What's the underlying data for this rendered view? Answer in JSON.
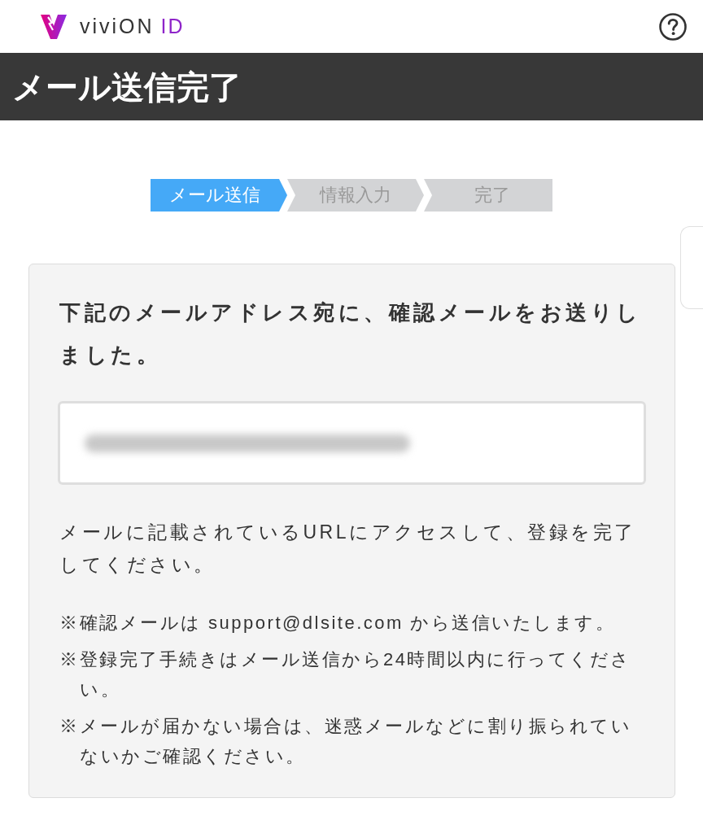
{
  "header": {
    "brand": {
      "name": "viviON",
      "suffix": "ID"
    }
  },
  "title": "メール送信完了",
  "steps": [
    {
      "label": "メール送信",
      "selected": true
    },
    {
      "label": "情報入力",
      "selected": false
    },
    {
      "label": "完了",
      "selected": false
    }
  ],
  "card": {
    "heading": "下記のメールアドレス宛に、確認メールをお送りしました。",
    "email_field": {
      "blurred": true
    },
    "instruction": "メールに記載されているURLにアクセスして、登録を完了してください。",
    "notes": [
      "※確認メールは support@dlsite.com から送信いたします。",
      "※登録完了手続きはメール送信から24時間以内に行ってください。",
      "※メールが届かない場合は、迷惑メールなどに割り振られていないかご確認ください。"
    ]
  }
}
